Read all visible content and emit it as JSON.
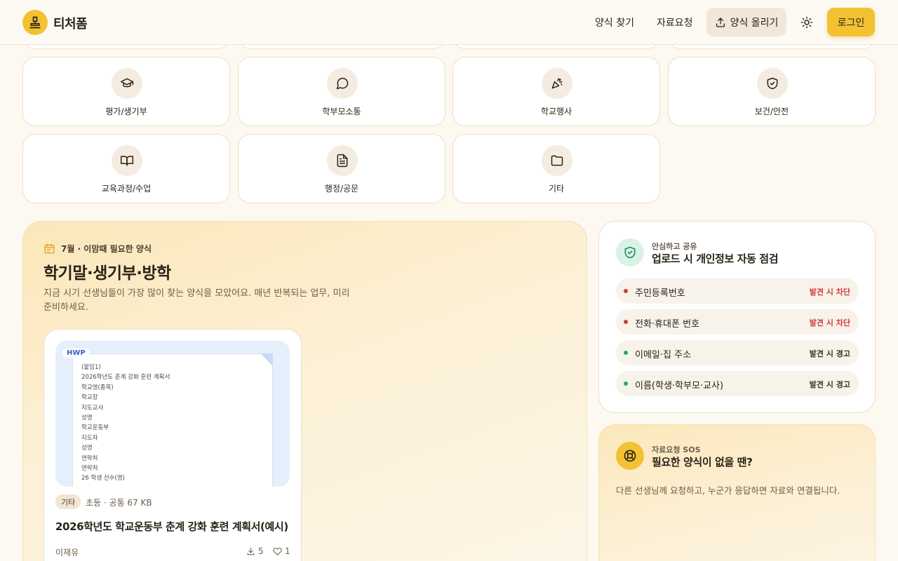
{
  "header": {
    "brand": "티처폼",
    "nav": [
      "양식 찾기",
      "자료요청"
    ],
    "upload_label": "양식 올리기",
    "login_label": "로그인"
  },
  "categories": [
    {
      "label": "평가/생기부",
      "icon": "graduation-cap-icon"
    },
    {
      "label": "학부모소통",
      "icon": "chat-bubble-icon"
    },
    {
      "label": "학교행사",
      "icon": "party-popper-icon"
    },
    {
      "label": "보건/안전",
      "icon": "shield-check-icon"
    },
    {
      "label": "교육과정/수업",
      "icon": "open-book-icon"
    },
    {
      "label": "행정/공문",
      "icon": "document-icon"
    },
    {
      "label": "기타",
      "icon": "folder-icon"
    }
  ],
  "season": {
    "kicker": "7월 · 이맘때 필요한 양식",
    "title": "학기말·생기부·방학",
    "description": "지금 시기 선생님들이 가장 많이 찾는 양식을 모았어요. 매년 반복되는 업무, 미리 준비하세요.",
    "doc": {
      "format": "HWP",
      "preview_lines": [
        "(붙임1)",
        "2026학년도 춘계 강화 훈련 계획서",
        "학교명(종목)",
        "학교장",
        "지도교사",
        "성명",
        "학교운동부",
        "지도자",
        "성명",
        "연락처",
        "연락처",
        "26 학생 선수(명)"
      ],
      "tag": "기타",
      "meta": "초등 · 공통  67 KB",
      "title": "2026학년도 학교운동부 춘계 강화 훈련 계획서(예시)",
      "author": "이재유",
      "downloads": "5",
      "likes": "1"
    }
  },
  "privacy": {
    "kicker": "안심하고 공유",
    "title": "업로드 시 개인정보 자동 점검",
    "items": [
      {
        "label": "주민등록번호",
        "status": "발견 시 차단",
        "level": "block"
      },
      {
        "label": "전화·휴대폰 번호",
        "status": "발견 시 차단",
        "level": "block"
      },
      {
        "label": "이메일·집 주소",
        "status": "발견 시 경고",
        "level": "warn"
      },
      {
        "label": "이름(학생·학부모·교사)",
        "status": "발견 시 경고",
        "level": "warn"
      }
    ]
  },
  "sos": {
    "kicker": "자료요청 SOS",
    "title": "필요한 양식이 없을 땐?",
    "description": "다른 선생님께 요청하고, 누군가 응답하면 자료와 연결됩니다."
  },
  "colors": {
    "accent": "#f3c233",
    "block": "#d23a3a",
    "warn": "#1faa6b"
  }
}
